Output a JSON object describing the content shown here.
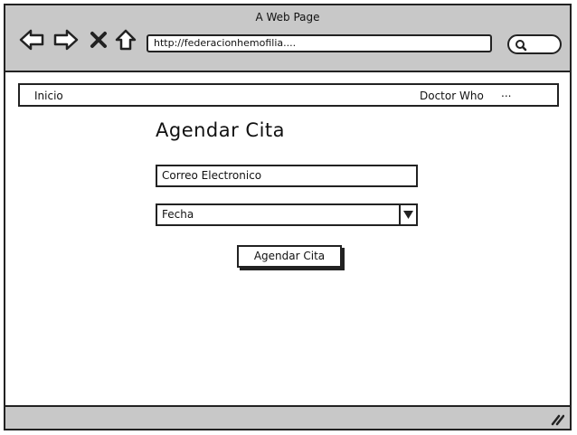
{
  "window": {
    "title": "A Web Page"
  },
  "toolbar": {
    "back_icon": "arrow-left-icon",
    "forward_icon": "arrow-right-icon",
    "stop_icon": "close-icon",
    "home_icon": "home-icon",
    "url": "http://federacionhemofilia....",
    "search_icon": "search-icon"
  },
  "menu": {
    "items": [
      {
        "label": "Inicio"
      },
      {
        "label": "Doctor Who"
      },
      {
        "label": "..."
      }
    ]
  },
  "main": {
    "heading": "Agendar Cita",
    "email_field": {
      "value": "Correo Electronico"
    },
    "date_select": {
      "selected": "Fecha",
      "arrow_icon": "triangle-down-icon"
    },
    "submit_button": {
      "label": "Agendar Cita"
    }
  },
  "statusbar": {
    "grip_icon": "resize-grip-icon"
  }
}
